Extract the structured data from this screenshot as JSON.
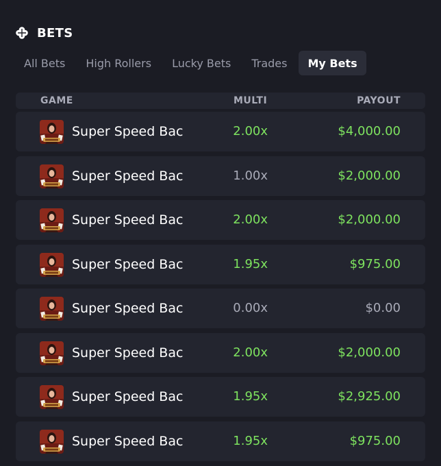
{
  "header": {
    "title": "BETS",
    "icon": "clover-icon"
  },
  "tabs": [
    {
      "label": "All Bets",
      "active": false
    },
    {
      "label": "High Rollers",
      "active": false
    },
    {
      "label": "Lucky Bets",
      "active": false
    },
    {
      "label": "Trades",
      "active": false
    },
    {
      "label": "My Bets",
      "active": true
    }
  ],
  "columns": {
    "game": "GAME",
    "multi": "MULTI",
    "payout": "PAYOUT"
  },
  "colors": {
    "win": "#7ee35f",
    "neutral": "#a9abb8",
    "row_bg": "#23252f",
    "page_bg": "#1b1c24"
  },
  "rows": [
    {
      "game": "Super Speed Bac",
      "multi": "2.00x",
      "payout": "$4,000.00",
      "win": true
    },
    {
      "game": "Super Speed Bac",
      "multi": "1.00x",
      "payout": "$2,000.00",
      "win": true,
      "multi_neutral": true
    },
    {
      "game": "Super Speed Bac",
      "multi": "2.00x",
      "payout": "$2,000.00",
      "win": true
    },
    {
      "game": "Super Speed Bac",
      "multi": "1.95x",
      "payout": "$975.00",
      "win": true
    },
    {
      "game": "Super Speed Bac",
      "multi": "0.00x",
      "payout": "$0.00",
      "win": false,
      "multi_neutral": true
    },
    {
      "game": "Super Speed Bac",
      "multi": "2.00x",
      "payout": "$2,000.00",
      "win": true
    },
    {
      "game": "Super Speed Bac",
      "multi": "1.95x",
      "payout": "$2,925.00",
      "win": true
    },
    {
      "game": "Super Speed Bac",
      "multi": "1.95x",
      "payout": "$975.00",
      "win": true
    }
  ]
}
